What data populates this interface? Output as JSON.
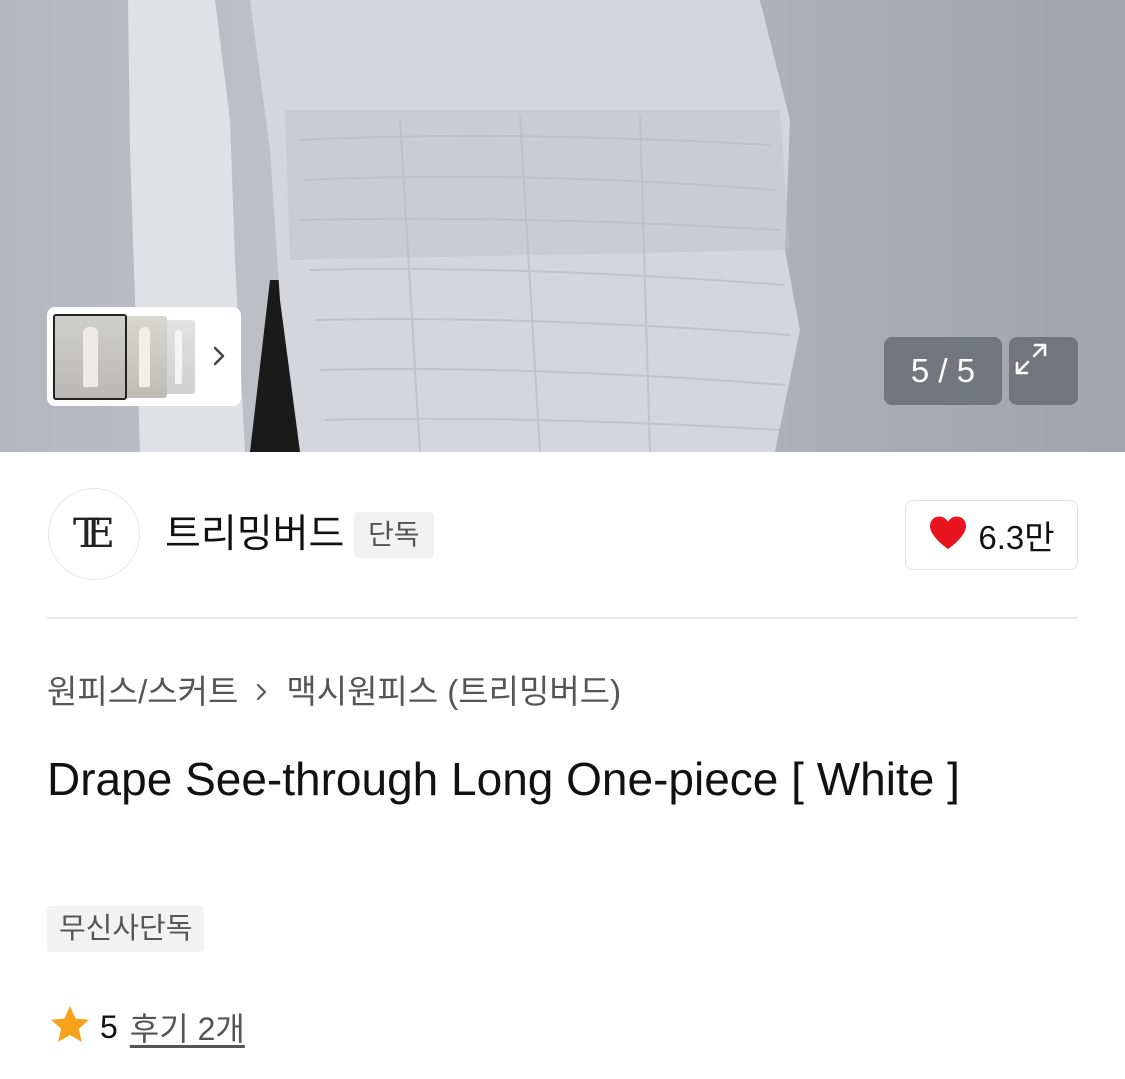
{
  "gallery": {
    "counter": "5 / 5",
    "icons": {
      "next": "chevron-right-icon",
      "expand": "expand-icon"
    }
  },
  "brand": {
    "logo_text": "TE",
    "name": "트리밍버드",
    "badge": "단독",
    "like_count": "6.3만",
    "like_color": "#e8141e"
  },
  "breadcrumb": {
    "category": "원피스/스커트",
    "subcategory": "맥시원피스 (트리밍버드)"
  },
  "product": {
    "title": "Drape See-through Long One-piece [ White ]",
    "tag": "무신사단독"
  },
  "rating": {
    "score": "5",
    "reviews_label": "후기 2개",
    "star_color": "#f7a21b"
  }
}
